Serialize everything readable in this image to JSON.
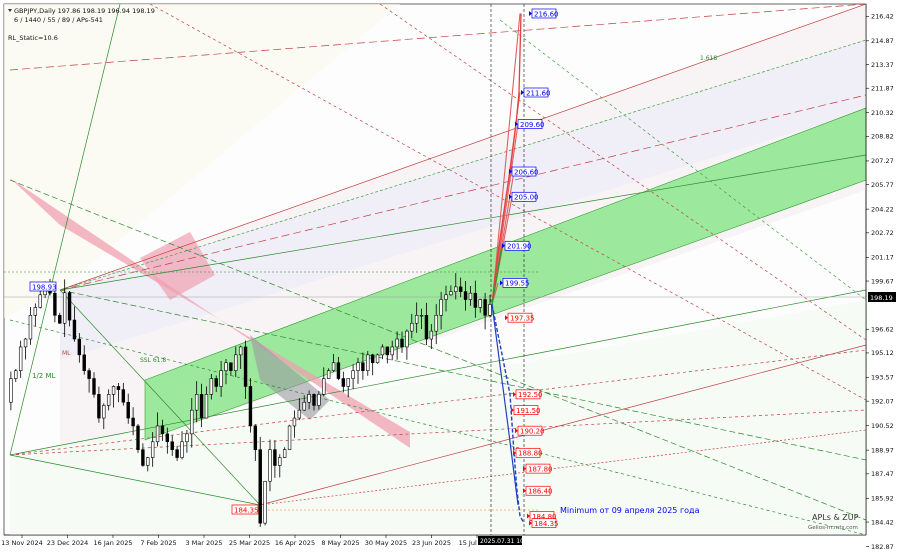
{
  "header": {
    "symbol_line": "GBPJPY,Daily  197.86 198.19 196.94 198.19",
    "settings_line": "6 / 1440 / 55 / 89 / APs-541",
    "rl_static": "RL_Static=10.6"
  },
  "chart_data": {
    "type": "candlestick",
    "symbol": "GBPJPY",
    "timeframe": "Daily",
    "ohlc": {
      "open": 197.86,
      "high": 198.19,
      "low": 196.94,
      "close": 198.19
    },
    "current_price": 198.19,
    "ylim": [
      183.6,
      217.2
    ],
    "y_ticks": [
      216.42,
      214.87,
      213.37,
      211.87,
      210.32,
      208.82,
      207.27,
      205.77,
      204.22,
      202.72,
      201.17,
      199.67,
      198.19,
      196.62,
      195.12,
      193.57,
      192.07,
      190.52,
      188.97,
      187.47,
      185.92,
      184.42,
      182.87
    ],
    "x_ticks": [
      "13 Nov 2024",
      "23 Dec 2024",
      "16 Jan 2025",
      "7 Feb 2025",
      "3 Mar 2025",
      "25 Mar 2025",
      "16 Apr 2025",
      "8 May 2025",
      "30 May 2025",
      "23 Jun 2025",
      "15 Jul 2025"
    ],
    "current_time_label": "2025.07.31 10:44",
    "price_path": [
      [
        0,
        192.0
      ],
      [
        5,
        193.5
      ],
      [
        10,
        194.0
      ],
      [
        15,
        195.5
      ],
      [
        20,
        196.0
      ],
      [
        25,
        197.5
      ],
      [
        30,
        198.0
      ],
      [
        35,
        198.8
      ],
      [
        40,
        199.2
      ],
      [
        45,
        198.9
      ],
      [
        50,
        197.5
      ],
      [
        55,
        197.0
      ],
      [
        60,
        198.93
      ],
      [
        65,
        197.2
      ],
      [
        70,
        196.0
      ],
      [
        75,
        195.0
      ],
      [
        80,
        194.0
      ],
      [
        85,
        193.5
      ],
      [
        90,
        192.5
      ],
      [
        95,
        191.0
      ],
      [
        100,
        191.8
      ],
      [
        105,
        192.5
      ],
      [
        110,
        193.0
      ],
      [
        115,
        192.8
      ],
      [
        120,
        192.0
      ],
      [
        125,
        191.0
      ],
      [
        130,
        190.5
      ],
      [
        135,
        189.0
      ],
      [
        140,
        188.0
      ],
      [
        145,
        188.5
      ],
      [
        150,
        189.5
      ],
      [
        155,
        190.5
      ],
      [
        160,
        190.0
      ],
      [
        165,
        189.5
      ],
      [
        170,
        189.0
      ],
      [
        175,
        188.5
      ],
      [
        180,
        189.5
      ],
      [
        185,
        190.0
      ],
      [
        190,
        191.5
      ],
      [
        195,
        192.5
      ],
      [
        200,
        191.0
      ],
      [
        205,
        192.5
      ],
      [
        210,
        193.5
      ],
      [
        215,
        193.0
      ],
      [
        220,
        194.0
      ],
      [
        225,
        194.5
      ],
      [
        230,
        194.0
      ],
      [
        235,
        195.0
      ],
      [
        240,
        195.5
      ],
      [
        245,
        193.0
      ],
      [
        250,
        190.5
      ],
      [
        255,
        189.0
      ],
      [
        260,
        184.35
      ],
      [
        265,
        187.0
      ],
      [
        270,
        189.0
      ],
      [
        275,
        188.0
      ],
      [
        280,
        188.5
      ],
      [
        285,
        189.0
      ],
      [
        290,
        190.5
      ],
      [
        295,
        191.0
      ],
      [
        300,
        191.5
      ],
      [
        305,
        192.0
      ],
      [
        310,
        192.5
      ],
      [
        315,
        191.8
      ],
      [
        320,
        192.5
      ],
      [
        325,
        193.5
      ],
      [
        330,
        194.0
      ],
      [
        335,
        194.5
      ],
      [
        340,
        193.5
      ],
      [
        345,
        193.0
      ],
      [
        350,
        193.5
      ],
      [
        355,
        194.0
      ],
      [
        360,
        194.5
      ],
      [
        365,
        194.0
      ],
      [
        370,
        195.0
      ],
      [
        375,
        194.5
      ],
      [
        380,
        195.0
      ],
      [
        385,
        195.5
      ],
      [
        390,
        195.0
      ],
      [
        395,
        195.5
      ],
      [
        400,
        196.0
      ],
      [
        405,
        195.5
      ],
      [
        410,
        196.5
      ],
      [
        415,
        197.0
      ],
      [
        420,
        197.5
      ],
      [
        425,
        197.5
      ],
      [
        430,
        196.0
      ],
      [
        435,
        196.5
      ],
      [
        440,
        197.5
      ],
      [
        445,
        198.5
      ],
      [
        450,
        198.8
      ],
      [
        455,
        199.0
      ],
      [
        460,
        199.3
      ],
      [
        465,
        199.0
      ],
      [
        470,
        198.5
      ],
      [
        475,
        198.9
      ],
      [
        480,
        198.0
      ],
      [
        485,
        198.5
      ],
      [
        490,
        197.5
      ],
      [
        495,
        198.19
      ]
    ],
    "targets_up": [
      {
        "label": "216.60",
        "value": 216.6,
        "color": "#0000ff"
      },
      {
        "label": "211.60",
        "value": 211.6,
        "color": "#0000ff"
      },
      {
        "label": "209.60",
        "value": 209.6,
        "color": "#0000ff"
      },
      {
        "label": "206.60",
        "value": 206.6,
        "color": "#0000ff"
      },
      {
        "label": "205.00",
        "value": 205.0,
        "color": "#0000ff"
      },
      {
        "label": "201.90",
        "value": 201.9,
        "color": "#0000ff"
      },
      {
        "label": "199.55",
        "value": 199.55,
        "color": "#0000ff"
      }
    ],
    "targets_down": [
      {
        "label": "197.35",
        "value": 197.35,
        "color": "#ff0000"
      },
      {
        "label": "192.50",
        "value": 192.5,
        "color": "#ff0000"
      },
      {
        "label": "191.50",
        "value": 191.5,
        "color": "#ff0000"
      },
      {
        "label": "190.20",
        "value": 190.2,
        "color": "#ff0000"
      },
      {
        "label": "188.80",
        "value": 188.8,
        "color": "#ff0000"
      },
      {
        "label": "187.80",
        "value": 187.8,
        "color": "#ff0000"
      },
      {
        "label": "186.40",
        "value": 186.4,
        "color": "#ff0000"
      },
      {
        "label": "184.80",
        "value": 184.8,
        "color": "#ff0000"
      },
      {
        "label": "184.35",
        "value": 184.35,
        "color": "#ff0000"
      }
    ],
    "swing_labels": [
      {
        "label": "198.93",
        "value": 198.93,
        "color": "#0000ff"
      },
      {
        "label": "184.35",
        "value": 184.35,
        "color": "#ff0000"
      }
    ],
    "fork_labels": [
      "1/2 ML",
      "ML",
      "SSL 61.8",
      "1.618"
    ],
    "annotation": "Minimum от 09 апреля 2025 года",
    "watermark": "APLs & ZUP",
    "watermark_site": "Gelios-m.mts.com",
    "colors": {
      "bull": "#000000",
      "bear": "#000000",
      "up_path": "#e06060",
      "down_path": "#2040c0",
      "channel": "#90ee90",
      "zone": "#f4a8b8",
      "price_box": "#000000"
    }
  }
}
